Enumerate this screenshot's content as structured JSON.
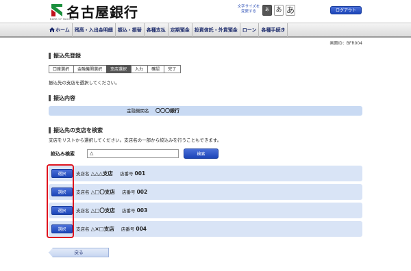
{
  "header": {
    "bank_name": "名古屋銀行",
    "logo_sub": "BANK OF NAGOYA",
    "font_size_label": "文字サイズを変更する",
    "font_sizes": [
      "あ",
      "あ",
      "あ"
    ],
    "logout": "ログアウト"
  },
  "nav": {
    "items": [
      "ホーム",
      "残高・入出金明細",
      "振込・振替",
      "各種支払",
      "定期預金",
      "投資信託・外貨預金",
      "ローン",
      "各種手続き"
    ]
  },
  "screen_id": "画面ID：BFR004",
  "page": {
    "title": "振込先登録",
    "steps": [
      "口座選択",
      "金融機関選択",
      "支店選択",
      "入力",
      "確認",
      "完了"
    ],
    "active_step": 2,
    "instruction": "振込先の支店を選択してください。"
  },
  "transfer": {
    "title": "振込内容",
    "bank_label": "金融機関名",
    "bank_value": "〇〇〇銀行"
  },
  "search": {
    "title": "振込先の支店を検索",
    "hint": "支店をリストから選択してください。支店名の一部から絞込みを行うこともできます。",
    "label": "絞込み検索",
    "value": "△",
    "button": "検索"
  },
  "branches": [
    {
      "select": "選択",
      "name_label": "支店名",
      "name": "△△△支店",
      "num_label": "店番号",
      "num": "001"
    },
    {
      "select": "選択",
      "name_label": "支店名",
      "name": "△□〇支店",
      "num_label": "店番号",
      "num": "002"
    },
    {
      "select": "選択",
      "name_label": "支店名",
      "name": "△□〇支店",
      "num_label": "店番号",
      "num": "003"
    },
    {
      "select": "選択",
      "name_label": "支店名",
      "name": "△×□支店",
      "num_label": "店番号",
      "num": "004"
    }
  ],
  "back": "戻る",
  "colors": {
    "accent": "#1c45b8",
    "row_bg": "#d9e4f6",
    "highlight": "#e0141e"
  }
}
